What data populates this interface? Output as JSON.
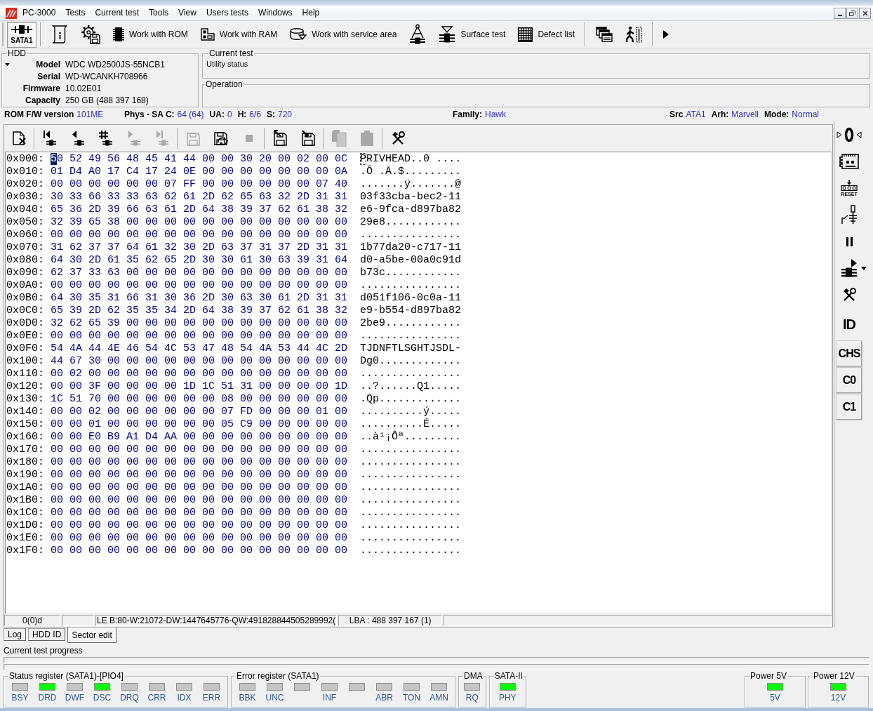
{
  "menu_bar": {
    "items": [
      "PC-3000",
      "Tests",
      "Current test",
      "Tools",
      "View",
      "Users tests",
      "Windows",
      "Help"
    ]
  },
  "toolbar": [
    {
      "kind": "port",
      "label": "SATA1",
      "pressed": true
    },
    {
      "kind": "separator"
    },
    {
      "kind": "passport",
      "pressed": false
    },
    {
      "kind": "gear-disk",
      "pressed": false
    },
    {
      "kind": "chip",
      "label": "Work with ROM",
      "pressed": false
    },
    {
      "kind": "ram",
      "label": "Work with RAM",
      "pressed": false
    },
    {
      "kind": "service",
      "label": "Work with service area",
      "pressed": false
    },
    {
      "kind": "heads",
      "pressed": false
    },
    {
      "kind": "surface",
      "label": "Surface test",
      "pressed": false
    },
    {
      "kind": "grid",
      "label": "Defect list",
      "pressed": false
    },
    {
      "kind": "separator"
    },
    {
      "kind": "windows",
      "pressed": false
    },
    {
      "kind": "exit",
      "pressed": false
    },
    {
      "kind": "separator"
    },
    {
      "kind": "more",
      "pressed": false
    }
  ],
  "hdd": {
    "title": "HDD",
    "fields": [
      {
        "label": "Model",
        "value": "WDC WD2500JS-55NCB1"
      },
      {
        "label": "Serial",
        "value": "WD-WCANKH708966"
      },
      {
        "label": "Firmware",
        "value": "10.02E01"
      },
      {
        "label": "Capacity",
        "value": "250 GB (488 397 168)"
      }
    ]
  },
  "current_test": {
    "title": "Current test",
    "status": "Utility status"
  },
  "operation": {
    "title": "Operation"
  },
  "info_bar": {
    "left": [
      {
        "label": "ROM F/W version",
        "value": "101ME"
      },
      {
        "label": "Phys - SA C:",
        "value": "64 (64)"
      },
      {
        "label": "UA:",
        "value": "0"
      },
      {
        "label": "H:",
        "value": "6/6"
      },
      {
        "label": "S:",
        "value": "720"
      }
    ],
    "center": [
      {
        "label": "Family:",
        "value": "Hawk"
      }
    ],
    "right": [
      {
        "label": "Src",
        "value": "ATA1"
      },
      {
        "label": "Arh:",
        "value": "Marvell"
      },
      {
        "label": "Mode:",
        "value": "Normal"
      }
    ]
  },
  "sector_editor": {
    "toolbar": [
      {
        "kind": "close",
        "disabled": false
      },
      {
        "kind": "separator"
      },
      {
        "kind": "first",
        "disabled": false
      },
      {
        "kind": "prev",
        "disabled": false
      },
      {
        "kind": "goto",
        "disabled": false
      },
      {
        "kind": "next",
        "disabled": true
      },
      {
        "kind": "last",
        "disabled": true
      },
      {
        "kind": "separator"
      },
      {
        "kind": "save",
        "disabled": true
      },
      {
        "kind": "reload",
        "disabled": false
      },
      {
        "kind": "stop",
        "disabled": true
      },
      {
        "kind": "separator"
      },
      {
        "kind": "load",
        "disabled": false
      },
      {
        "kind": "export",
        "disabled": false
      },
      {
        "kind": "separator"
      },
      {
        "kind": "copy",
        "disabled": true
      },
      {
        "kind": "paste",
        "disabled": true
      },
      {
        "kind": "separator"
      },
      {
        "kind": "tools",
        "disabled": false
      }
    ],
    "rows": [
      {
        "offset": "0x000:",
        "bytes": "50 52 49 56 48 45 41 44 00 00 30 20 00 02 00 0C",
        "ascii": "PRIVHEAD..0 ....",
        "cursor": true
      },
      {
        "offset": "0x010:",
        "bytes": "01 D4 A0 17 C4 17 24 0E 00 00 00 00 00 00 00 0A",
        "ascii": ".Ô .Ä.$.........",
        "cursor": false
      },
      {
        "offset": "0x020:",
        "bytes": "00 00 00 00 00 00 07 FF 00 00 00 00 00 00 07 40",
        "ascii": ".......ÿ.......@",
        "cursor": false
      },
      {
        "offset": "0x030:",
        "bytes": "30 33 66 33 33 63 62 61 2D 62 65 63 32 2D 31 31",
        "ascii": "03f33cba-bec2-11",
        "cursor": false
      },
      {
        "offset": "0x040:",
        "bytes": "65 36 2D 39 66 63 61 2D 64 38 39 37 62 61 38 32",
        "ascii": "e6-9fca-d897ba82",
        "cursor": false
      },
      {
        "offset": "0x050:",
        "bytes": "32 39 65 38 00 00 00 00 00 00 00 00 00 00 00 00",
        "ascii": "29e8............",
        "cursor": false
      },
      {
        "offset": "0x060:",
        "bytes": "00 00 00 00 00 00 00 00 00 00 00 00 00 00 00 00",
        "ascii": "................",
        "cursor": false
      },
      {
        "offset": "0x070:",
        "bytes": "31 62 37 37 64 61 32 30 2D 63 37 31 37 2D 31 31",
        "ascii": "1b77da20-c717-11",
        "cursor": false
      },
      {
        "offset": "0x080:",
        "bytes": "64 30 2D 61 35 62 65 2D 30 30 61 30 63 39 31 64",
        "ascii": "d0-a5be-00a0c91d",
        "cursor": false
      },
      {
        "offset": "0x090:",
        "bytes": "62 37 33 63 00 00 00 00 00 00 00 00 00 00 00 00",
        "ascii": "b73c............",
        "cursor": false
      },
      {
        "offset": "0x0A0:",
        "bytes": "00 00 00 00 00 00 00 00 00 00 00 00 00 00 00 00",
        "ascii": "................",
        "cursor": false
      },
      {
        "offset": "0x0B0:",
        "bytes": "64 30 35 31 66 31 30 36 2D 30 63 30 61 2D 31 31",
        "ascii": "d051f106-0c0a-11",
        "cursor": false
      },
      {
        "offset": "0x0C0:",
        "bytes": "65 39 2D 62 35 35 34 2D 64 38 39 37 62 61 38 32",
        "ascii": "e9-b554-d897ba82",
        "cursor": false
      },
      {
        "offset": "0x0D0:",
        "bytes": "32 62 65 39 00 00 00 00 00 00 00 00 00 00 00 00",
        "ascii": "2be9............",
        "cursor": false
      },
      {
        "offset": "0x0E0:",
        "bytes": "00 00 00 00 00 00 00 00 00 00 00 00 00 00 00 00",
        "ascii": "................",
        "cursor": false
      },
      {
        "offset": "0x0F0:",
        "bytes": "54 4A 44 4E 46 54 4C 53 47 48 54 4A 53 44 4C 2D",
        "ascii": "TJDNFTLSGHTJSDL-",
        "cursor": false
      },
      {
        "offset": "0x100:",
        "bytes": "44 67 30 00 00 00 00 00 00 00 00 00 00 00 00 00",
        "ascii": "Dg0.............",
        "cursor": false
      },
      {
        "offset": "0x110:",
        "bytes": "00 02 00 00 00 00 00 00 00 00 00 00 00 00 00 00",
        "ascii": "................",
        "cursor": false
      },
      {
        "offset": "0x120:",
        "bytes": "00 00 3F 00 00 00 00 1D 1C 51 31 00 00 00 00 1D",
        "ascii": "..?......Q1.....",
        "cursor": false
      },
      {
        "offset": "0x130:",
        "bytes": "1C 51 70 00 00 00 00 00 00 08 00 00 00 00 00 00",
        "ascii": ".Qp.............",
        "cursor": false
      },
      {
        "offset": "0x140:",
        "bytes": "00 00 02 00 00 00 00 00 00 07 FD 00 00 00 01 00",
        "ascii": "..........ý.....",
        "cursor": false
      },
      {
        "offset": "0x150:",
        "bytes": "00 00 01 00 00 00 00 00 00 05 C9 00 00 00 00 00",
        "ascii": "..........É.....",
        "cursor": false
      },
      {
        "offset": "0x160:",
        "bytes": "00 00 E0 B9 A1 D4 AA 00 00 00 00 00 00 00 00 00",
        "ascii": "..à¹¡Ôª.........",
        "cursor": false
      },
      {
        "offset": "0x170:",
        "bytes": "00 00 00 00 00 00 00 00 00 00 00 00 00 00 00 00",
        "ascii": "................",
        "cursor": false
      },
      {
        "offset": "0x180:",
        "bytes": "00 00 00 00 00 00 00 00 00 00 00 00 00 00 00 00",
        "ascii": "................",
        "cursor": false
      },
      {
        "offset": "0x190:",
        "bytes": "00 00 00 00 00 00 00 00 00 00 00 00 00 00 00 00",
        "ascii": "................",
        "cursor": false
      },
      {
        "offset": "0x1A0:",
        "bytes": "00 00 00 00 00 00 00 00 00 00 00 00 00 00 00 00",
        "ascii": "................",
        "cursor": false
      },
      {
        "offset": "0x1B0:",
        "bytes": "00 00 00 00 00 00 00 00 00 00 00 00 00 00 00 00",
        "ascii": "................",
        "cursor": false
      },
      {
        "offset": "0x1C0:",
        "bytes": "00 00 00 00 00 00 00 00 00 00 00 00 00 00 00 00",
        "ascii": "................",
        "cursor": false
      },
      {
        "offset": "0x1D0:",
        "bytes": "00 00 00 00 00 00 00 00 00 00 00 00 00 00 00 00",
        "ascii": "................",
        "cursor": false
      },
      {
        "offset": "0x1E0:",
        "bytes": "00 00 00 00 00 00 00 00 00 00 00 00 00 00 00 00",
        "ascii": "................",
        "cursor": false
      },
      {
        "offset": "0x1F0:",
        "bytes": "00 00 00 00 00 00 00 00 00 00 00 00 00 00 00 00",
        "ascii": "................",
        "cursor": false
      }
    ],
    "status_bar": {
      "position": "0(0)d",
      "value": "LE B:80-W:21072-DW:1447645776-QW:491828844505289992(",
      "lba": "LBA : 488 397 167 (1)"
    }
  },
  "side_toolbar": [
    {
      "kind": "zero"
    },
    {
      "kind": "board"
    },
    {
      "kind": "reset",
      "label": "RESET"
    },
    {
      "kind": "switch"
    },
    {
      "kind": "pause"
    },
    {
      "kind": "run"
    },
    {
      "kind": "tools"
    },
    {
      "kind": "text",
      "label": "ID"
    },
    {
      "kind": "boxed",
      "label": "CHS"
    },
    {
      "kind": "boxed",
      "label": "C0"
    },
    {
      "kind": "boxed",
      "label": "C1"
    }
  ],
  "tabs": [
    {
      "label": "Log",
      "selected": false
    },
    {
      "label": "HDD ID",
      "selected": false
    },
    {
      "label": "Sector edit",
      "selected": true
    }
  ],
  "progress": {
    "label": "Current test progress",
    "bars": [
      {
        "level": 0
      },
      {
        "level": 0
      }
    ]
  },
  "registers": [
    {
      "title": "Status register (SATA1)-[PIO4]",
      "leds": [
        {
          "label": "BSY",
          "on": false
        },
        {
          "label": "DRD",
          "on": true
        },
        {
          "label": "DWF",
          "on": false
        },
        {
          "label": "DSC",
          "on": true
        },
        {
          "label": "DRQ",
          "on": false
        },
        {
          "label": "CRR",
          "on": false
        },
        {
          "label": "IDX",
          "on": false
        },
        {
          "label": "ERR",
          "on": false
        }
      ]
    },
    {
      "title": "Error register (SATA1)",
      "leds": [
        {
          "label": "BBK",
          "on": false
        },
        {
          "label": "UNC",
          "on": false
        },
        {
          "on": false
        },
        {
          "label": "INF",
          "on": false
        },
        {
          "on": false
        },
        {
          "label": "ABR",
          "on": false
        },
        {
          "label": "TON",
          "on": false
        },
        {
          "label": "AMN",
          "on": false
        }
      ]
    },
    {
      "title": "DMA",
      "leds": [
        {
          "label": "RQ",
          "on": false
        }
      ]
    },
    {
      "title": "SATA-II",
      "leds": [
        {
          "label": "PHY",
          "on": true
        }
      ]
    }
  ],
  "power": [
    {
      "title": "Power 5V",
      "leds": [
        {
          "label": "5V",
          "on": true
        }
      ]
    },
    {
      "title": "Power 12V",
      "leds": [
        {
          "label": "12V",
          "on": true
        }
      ]
    }
  ]
}
